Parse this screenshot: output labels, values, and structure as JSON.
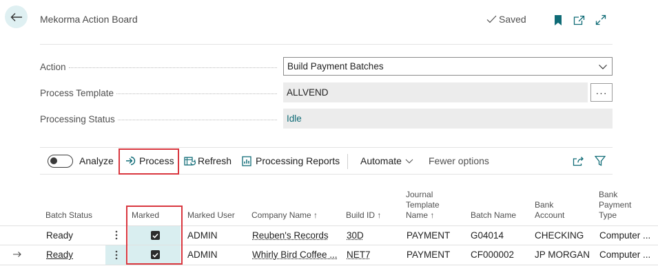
{
  "header": {
    "title": "Mekorma Action Board",
    "saved_label": "Saved"
  },
  "fields": {
    "action": {
      "label": "Action",
      "value": "Build Payment Batches"
    },
    "process_template": {
      "label": "Process Template",
      "value": "ALLVEND"
    },
    "processing_status": {
      "label": "Processing Status",
      "value": "Idle"
    }
  },
  "toolbar": {
    "analyze": "Analyze",
    "process": "Process",
    "refresh": "Refresh",
    "processing_reports": "Processing Reports",
    "automate": "Automate",
    "fewer_options": "Fewer options"
  },
  "table": {
    "headers": {
      "batch_status": "Batch Status",
      "marked": "Marked",
      "marked_user": "Marked User",
      "company_name": "Company Name",
      "build_id": "Build ID",
      "journal_template_name": [
        "Journal",
        "Template",
        "Name"
      ],
      "batch_name": "Batch Name",
      "bank_account": [
        "Bank",
        "Account"
      ],
      "bank_payment_type": [
        "Bank",
        "Payment",
        "Type"
      ]
    },
    "rows": [
      {
        "batch_status": "Ready",
        "marked": true,
        "marked_user": "ADMIN",
        "company_name": "Reuben's Records",
        "build_id": "30D",
        "journal_template_name": "PAYMENT",
        "batch_name": "G04014",
        "bank_account": "CHECKING",
        "bank_payment_type": "Computer ..."
      },
      {
        "batch_status": "Ready",
        "marked": true,
        "marked_user": "ADMIN",
        "company_name": "Whirly Bird Coffee ...",
        "build_id": "NET7",
        "journal_template_name": "PAYMENT",
        "batch_name": "CF000002",
        "bank_account": "JP MORGAN",
        "bank_payment_type": "Computer ..."
      }
    ]
  },
  "colors": {
    "accent": "#0f6b76",
    "highlight_box": "#d9363e",
    "selected_cell": "#d9eef0"
  }
}
